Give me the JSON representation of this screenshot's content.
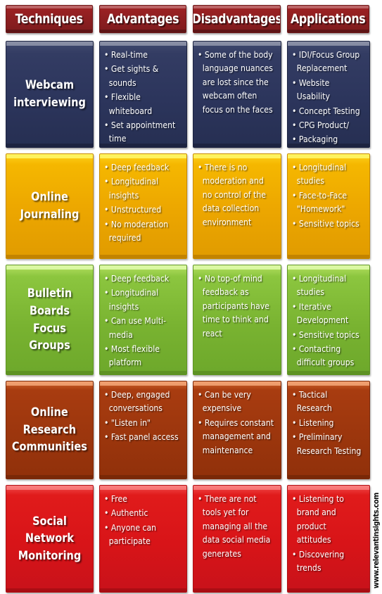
{
  "watermark": "www.relevantinsights.com",
  "table": {
    "headers": [
      {
        "label": "Techniques"
      },
      {
        "label": "Advantages"
      },
      {
        "label": "Disadvantages"
      },
      {
        "label": "Applications"
      }
    ],
    "rows": [
      {
        "theme": "navy",
        "color": "#2c355c",
        "technique": "Webcam interviewing",
        "advantages": [
          "Real-time",
          "Get sights & sounds",
          "Flexible whiteboard",
          "Set appointment time"
        ],
        "disadvantages": [
          "Some of the body language nuances are lost since the webcam often focus on the faces"
        ],
        "applications": [
          "IDI/Focus Group Replacement",
          "Website Usability",
          "Concept Testing",
          "CPG Product/",
          "Packaging Testing"
        ]
      },
      {
        "theme": "gold",
        "color": "#eca600",
        "technique": "Online Journaling",
        "advantages": [
          "Deep  feedback",
          "Longitudinal insights",
          "Unstructured",
          "No moderation required"
        ],
        "disadvantages": [
          "There  is no moderation and no control of the  data collection environment"
        ],
        "applications": [
          "Longitudinal studies",
          "Face-to-Face \"Homework\"",
          "Sensitive topics"
        ]
      },
      {
        "theme": "green",
        "color": "#79b331",
        "technique": "Bulletin Boards Focus Groups",
        "advantages": [
          "Deep  feedback",
          "Longitudinal insights",
          "Can use Multi-media",
          "Most flexible platform"
        ],
        "disadvantages": [
          "No top-of mind feedback as participants have time to think  and react"
        ],
        "applications": [
          "Longitudinal studies",
          "Iterative Development",
          "Sensitive topics",
          "Contacting difficult groups"
        ]
      },
      {
        "theme": "brown",
        "color": "#9c360d",
        "technique": "Online Research Communities",
        "advantages": [
          "Deep, engaged conversations",
          "\"Listen in\"",
          "Fast panel access"
        ],
        "disadvantages": [
          "Can be very expensive",
          "Requires constant management and maintenance"
        ],
        "applications": [
          "Tactical Research",
          "Listening",
          "Preliminary Research Testing"
        ]
      },
      {
        "theme": "red",
        "color": "#d81418",
        "technique": "Social Network Monitoring",
        "advantages": [
          "Free",
          "Authentic",
          "Anyone can participate"
        ],
        "disadvantages": [
          "There  are not tools yet for managing all the data social media generates"
        ],
        "applications": [
          "Listening to brand and product attitudes",
          "Discovering trends"
        ]
      }
    ]
  }
}
